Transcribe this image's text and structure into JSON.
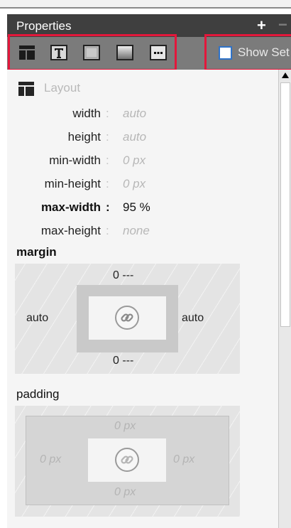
{
  "panel": {
    "title": "Properties",
    "add_icon": "plus-icon",
    "remove_icon": "minus-icon"
  },
  "toolbar": {
    "tools": [
      {
        "name": "layout-icon"
      },
      {
        "name": "text-icon"
      },
      {
        "name": "border-icon"
      },
      {
        "name": "gradient-icon"
      },
      {
        "name": "more-icon"
      }
    ],
    "show_set_label": "Show Set",
    "show_set_checked": false
  },
  "layout_section": {
    "label": "Layout",
    "icon": "layout-icon",
    "properties": [
      {
        "name": "width",
        "sep": ":",
        "value": "auto",
        "set": false
      },
      {
        "name": "height",
        "sep": ":",
        "value": "auto",
        "set": false
      },
      {
        "name": "min-width",
        "sep": ":",
        "value": "0 px",
        "set": false
      },
      {
        "name": "min-height",
        "sep": ":",
        "value": "0 px",
        "set": false
      },
      {
        "name": "max-width",
        "sep": ":",
        "value": "95 %",
        "set": true
      },
      {
        "name": "max-height",
        "sep": ":",
        "value": "none",
        "set": false
      }
    ]
  },
  "margin": {
    "label": "margin",
    "top": "0 ---",
    "bottom": "0 ---",
    "left": "auto",
    "right": "auto",
    "link_icon": "link-icon"
  },
  "padding": {
    "label": "padding",
    "top": "0 px",
    "bottom": "0 px",
    "left": "0 px",
    "right": "0 px",
    "link_icon": "link-icon"
  },
  "colors": {
    "titlebar": "#3f3f3f",
    "toolbar": "#7b7b7b",
    "highlight": "#e3173b",
    "checkbox_border": "#2f73c9"
  }
}
